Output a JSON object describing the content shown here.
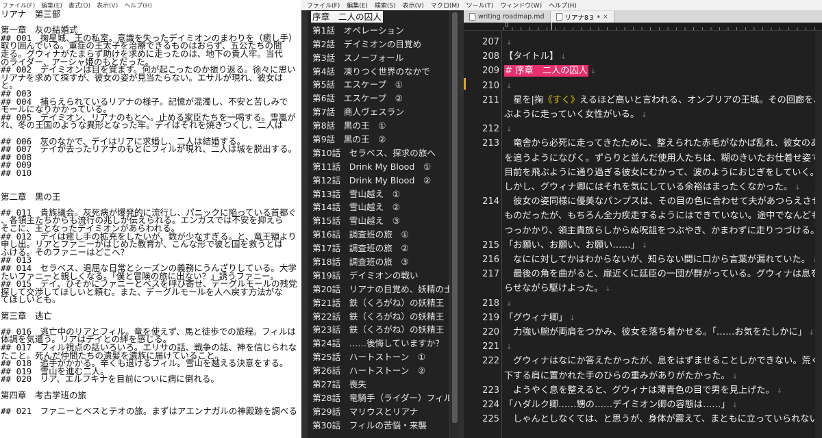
{
  "left_window": {
    "menu": [
      "ファイル(F)",
      "編集(E)",
      "書式(O)",
      "表示(V)",
      "ヘルプ(H)"
    ],
    "lines": [
      "リアナ　第三部",
      "",
      "第一章　灰の結婚式",
      "## 001　掬星城、王の私室。意識を失ったデイミオンのまわりを（癒し手）",
      "取り囲んでいる。重症の王太子を治療できるものはおらず、五公たちの間",
      "走る。グウィナがたまらず助けを求めに走ったのは、地下の貴人牢。当代",
      "のライダー、アーシャ姫のもとだった。",
      "## 002　デイミオンは目を覚ます。何が起こったのか振り返る。徐々に思い",
      "リアナを求めて探すが、彼女の姿が見当たらない。エサルが現れ、彼女は",
      "と。",
      "## 003",
      "## 004　捕らえられているリアナの様子。記憶が混濁し、不安と苦しみで",
      "モールになりかかっている。",
      "## 005　デイミオン、リアナのもとへ。止める家臣たちを一喝する。雪嵐が",
      "れ、冬の王国のような異形となった牢。デイはそれを焼きつくし、二人は",
      "",
      "## 006　灰のなかで、デイはリアに求婚し、二人は結婚する。",
      "## 007　デイが去ったリアナのもとにフィルが現れ、二人は城を脱出する。",
      "## 008",
      "## 009",
      "## 010",
      "",
      "",
      "第二章　黒の王",
      "",
      "## 011　貴族議会。灰死病が爆発的に流行し、パニックに陥っている首都ぐ",
      "、各領主たちからも流行の兆しが伝えられる。エンガスでは不安を抑えら",
      "そこに、王となったデイミオンがあらわれる。",
      "## 012　デイは癒し手の拡充をしたいが、数が少なすぎる。と、竜王額より",
      "申し出。リアとファニーがはじめた教育が、こんな形で彼と国を救うとは",
      "ふける。そのファニーはどこへ？",
      "## 013",
      "## 014　セラベス、退屈な日常とシーズンの義務にうんざりしている。大学",
      "たいファニーと親しくなる。「僕と冒険の旅に出ない？」誘うファニー。",
      "## 015　デイ、ひそかにファニーとベスを呼び寄せ、デーグルモールの残党",
      "探して交渉してほしいと頼む。また、デーグルモールを人へ戻す方法がな",
      "てほしいとも。",
      "",
      "第三章　逃亡",
      "",
      "## 016　逃亡中のリアとフィル。竜を使えず、馬と徒歩での旅程。フィルは",
      "体調を気遣う。リアはデイとの絆を感じる。",
      "## 017　フィル視点の話いろいろ。エリサの話、戦争の話、神を信じられな",
      "たこと。死んだ仲間たちの遺髪を遺族に届けていること。",
      "## 018　追手がかかる。辛くも退けるフィル。雪山を越える決意をする。",
      "## 019　雪山を進む二人。",
      "## 020　リア、エルフキナを目前についに病に倒れる。",
      "",
      "第四章　考古学班の旅",
      "",
      "## 021　ファニーとベスとテオの旅。まずはアエンナガルの神殿跡を調べる"
    ]
  },
  "right_window": {
    "menu": [
      "ファイル(F)",
      "編集(E)",
      "検索(S)",
      "表示(V)",
      "マクロ(M)",
      "ツール(T)",
      "ウィンドウ(W)",
      "ヘルプ(H)"
    ],
    "outline": [
      "序章　二人の囚人",
      "第1話　オペレーション",
      "第2話　デイミオンの目覚め",
      "第3話　スノーフォール",
      "第4話　凍りつく世界のなかで",
      "第5話　エスケープ　①",
      "第6話　エスケープ　②",
      "第7話　商人ヴェスラン",
      "第8話　黒の王　①",
      "第9話　黒の王　②",
      "第10話　セラベス、探求の旅へ",
      "第11話　Drink My Blood　①",
      "第12話　Drink My Blood　②",
      "第13話　雪山越え　①",
      "第14話　雪山越え　②",
      "第15話　雪山越え　③",
      "第16話　調査班の旅　①",
      "第17話　調査班の旅　②",
      "第18話　調査班の旅　③",
      "第19話　デイミオンの戦い",
      "第20話　リアナの目覚め、妖精の士",
      "第21話　鉄（くろがね）の妖精王",
      "第22話　鉄（くろがね）の妖精王",
      "第23話　鉄（くろがね）の妖精王",
      "第24話　……後悔していますか？",
      "第25話　ハートストーン　①",
      "第26話　ハートストーン　②",
      "第27話　喪失",
      "第28話　竜騎手（ライダー）フィル",
      "第29話　マリウスとリアナ",
      "第30話　フィルの苦悩・来襲"
    ],
    "outline_selected": 0,
    "tabs": [
      {
        "label": "writing roadmap.md",
        "close": ""
      },
      {
        "label": "リアナ8３ *",
        "close": "×"
      }
    ],
    "ruler_zero": "0",
    "editor": {
      "return_mark": "↓",
      "lines": [
        {
          "n": "207",
          "segs": [
            {
              "t": ""
            }
          ]
        },
        {
          "n": "208",
          "segs": [
            {
              "t": "【タイトル】"
            }
          ]
        },
        {
          "n": "209",
          "segs": [
            {
              "t": "# 序章　二人の囚人",
              "hl": true
            }
          ]
        },
        {
          "n": "210",
          "segs": [
            {
              "t": ""
            }
          ]
        },
        {
          "n": "211",
          "segs": [
            {
              "t": "　星を|掬"
            },
            {
              "t": "《すく》",
              "ruby": true
            },
            {
              "t": "えるほど高いと言われる、オンブリアの王城。その回廊を、飛"
            }
          ]
        },
        {
          "n": "",
          "segs": [
            {
              "t": "ぶように走っていく女性がいる。"
            }
          ]
        },
        {
          "n": "212",
          "segs": [
            {
              "t": ""
            }
          ]
        },
        {
          "n": "213",
          "segs": [
            {
              "t": "　竜舎から必死に走ってきたために、整えられた赤毛がなかば乱れ、彼女のあと"
            }
          ]
        },
        {
          "n": "",
          "segs": [
            {
              "t": "を追うようになびく。ずらりと並んだ使用人たちは、糊のきいたお仕着せ姿で、"
            }
          ]
        },
        {
          "n": "",
          "segs": [
            {
              "t": "目前を飛ぶように通り過ぎる彼女にむかって、波のようにおじぎをしていく。"
            }
          ]
        },
        {
          "n": "",
          "segs": [
            {
              "t": "しかし、グウィナ卿にはそれを気にしている余裕はまったくなかった。"
            }
          ]
        },
        {
          "n": "214",
          "segs": [
            {
              "t": "　彼女の姿同様に優美なパンプスは、その目の色に合わせて夫があつらえさせた"
            }
          ]
        },
        {
          "n": "",
          "segs": [
            {
              "t": "ものだったが、もちろん全力疾走するようにはできていない。途中でなんども"
            }
          ]
        },
        {
          "n": "",
          "segs": [
            {
              "t": "つっかかり、領主貴族らしからぬ呪詛をつぶやき、かまわずに走りつづける。"
            }
          ]
        },
        {
          "n": "215",
          "segs": [
            {
              "t": "「お願い、お願い、お願い……」"
            }
          ]
        },
        {
          "n": "216",
          "segs": [
            {
              "t": "　なにに対してかはわからないが、知らない間に口から言葉が漏れていた。"
            }
          ]
        },
        {
          "n": "217",
          "segs": [
            {
              "t": "　最後の角を曲がると、扉近くに廷臣の一団が群がっている。グウィナは息を切"
            }
          ]
        },
        {
          "n": "",
          "segs": [
            {
              "t": "らせながら駆けよった。"
            }
          ]
        },
        {
          "n": "218",
          "segs": [
            {
              "t": ""
            }
          ]
        },
        {
          "n": "219",
          "segs": [
            {
              "t": "「グウィナ卿」"
            }
          ]
        },
        {
          "n": "220",
          "segs": [
            {
              "t": "　力強い腕が両肩をつかみ、彼女を落ち着かせる。「……お気をたしかに」"
            }
          ]
        },
        {
          "n": "221",
          "segs": [
            {
              "t": ""
            }
          ]
        },
        {
          "n": "222",
          "segs": [
            {
              "t": "　グウィナはなにか答えたかったが、息をはずませることしかできない。荒く上"
            }
          ]
        },
        {
          "n": "",
          "segs": [
            {
              "t": "下する肩に置かれた手のひらの重みがありがたかった。"
            }
          ]
        },
        {
          "n": "223",
          "segs": [
            {
              "t": "　ようやく息を整えると、グウィナは薄青色の目で男を見上げた。"
            }
          ]
        },
        {
          "n": "224",
          "segs": [
            {
              "t": "「ハダルク卿……甥の……デイミオン卿の容態は……」"
            }
          ]
        },
        {
          "n": "225",
          "segs": [
            {
              "t": "　しゃんとしなくては、と思うが、身体が震えて、まともに立っていられない"
            }
          ]
        }
      ]
    }
  }
}
